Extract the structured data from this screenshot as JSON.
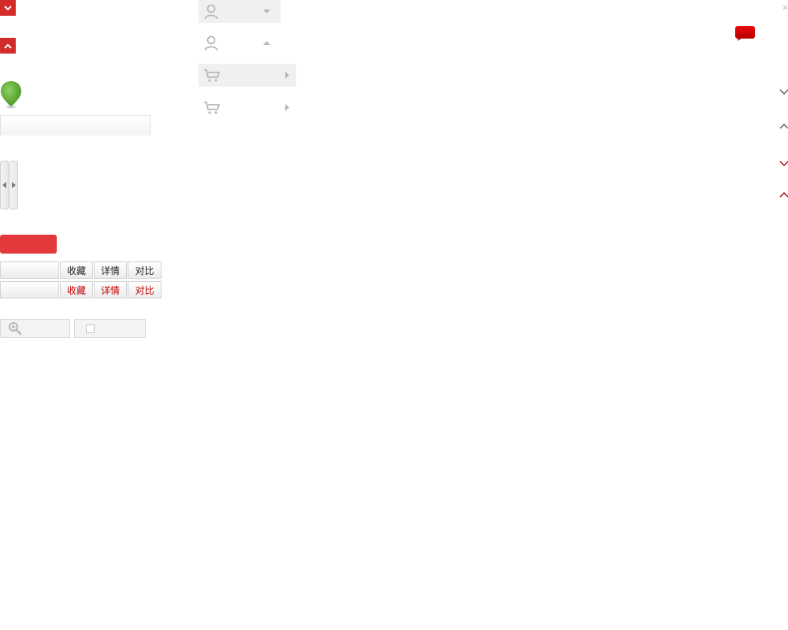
{
  "buttons": {
    "collect": "收藏",
    "detail": "详情",
    "compare": "对比"
  },
  "icons": {
    "dropdown_toggle": "chevron-down-icon",
    "collapse_toggle": "chevron-up-icon",
    "location": "map-pin-icon",
    "user": "user-icon",
    "cart": "cart-icon",
    "zoom": "zoom-in-icon",
    "chat": "chat-bubble-icon",
    "close": "close-icon"
  },
  "colors": {
    "accent_red": "#e4393c",
    "toggle_red": "#d32a2a",
    "dark_red": "#c40000",
    "pin_green": "#6cb33f",
    "neutral_gray": "#b8b8b8"
  }
}
